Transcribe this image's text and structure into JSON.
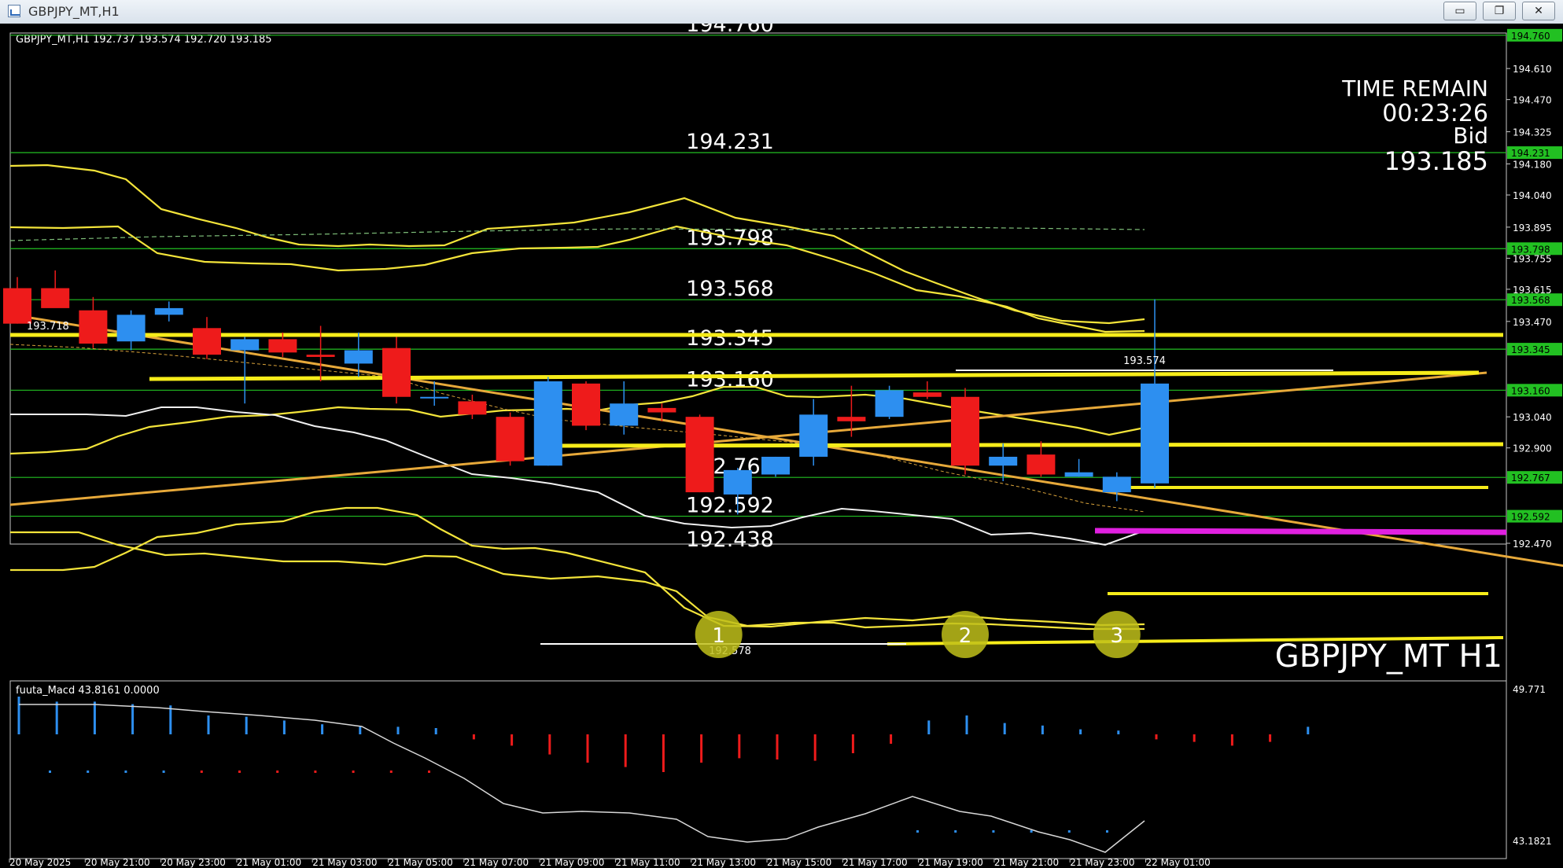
{
  "window": {
    "title": "GBPJPY_MT,H1",
    "min_glyph": "▭",
    "restore_glyph": "❐",
    "close_glyph": "✕"
  },
  "chart_data": {
    "type": "candlestick",
    "title": "GBPJPY_MT,H1",
    "header": "GBPJPY_MT,H1  192.737 193.574 192.720 193.185",
    "watermark": "GBPJPY_MT H1",
    "ylim": [
      192.47,
      194.77
    ],
    "time_remain": {
      "label": "TIME REMAIN",
      "value": "00:23:26",
      "bid_label": "Bid",
      "bid": "193.185"
    },
    "y_ticks": [
      "194.610",
      "194.470",
      "194.325",
      "194.180",
      "194.040",
      "193.895",
      "193.755",
      "193.615",
      "193.470",
      "193.040",
      "192.900",
      "192.470"
    ],
    "x_labels": [
      "20 May 2025",
      "20 May 21:00",
      "20 May 23:00",
      "21 May 01:00",
      "21 May 03:00",
      "21 May 05:00",
      "21 May 07:00",
      "21 May 09:00",
      "21 May 11:00",
      "21 May 13:00",
      "21 May 15:00",
      "21 May 17:00",
      "21 May 19:00",
      "21 May 21:00",
      "21 May 23:00",
      "22 May 01:00"
    ],
    "candles": [
      {
        "o": 193.62,
        "h": 193.67,
        "l": 193.46,
        "c": 193.46
      },
      {
        "o": 193.62,
        "h": 193.7,
        "l": 193.55,
        "c": 193.53
      },
      {
        "o": 193.52,
        "h": 193.58,
        "l": 193.35,
        "c": 193.37
      },
      {
        "o": 193.38,
        "h": 193.52,
        "l": 193.34,
        "c": 193.5
      },
      {
        "o": 193.5,
        "h": 193.56,
        "l": 193.47,
        "c": 193.53
      },
      {
        "o": 193.44,
        "h": 193.49,
        "l": 193.3,
        "c": 193.32
      },
      {
        "o": 193.34,
        "h": 193.4,
        "l": 193.1,
        "c": 193.39
      },
      {
        "o": 193.39,
        "h": 193.42,
        "l": 193.31,
        "c": 193.33
      },
      {
        "o": 193.32,
        "h": 193.45,
        "l": 193.2,
        "c": 193.31
      },
      {
        "o": 193.28,
        "h": 193.42,
        "l": 193.22,
        "c": 193.34
      },
      {
        "o": 193.35,
        "h": 193.4,
        "l": 193.1,
        "c": 193.13
      },
      {
        "o": 193.13,
        "h": 193.2,
        "l": 193.09,
        "c": 193.13
      },
      {
        "o": 193.11,
        "h": 193.14,
        "l": 193.03,
        "c": 193.05
      },
      {
        "o": 193.04,
        "h": 193.06,
        "l": 192.82,
        "c": 192.84
      },
      {
        "o": 192.82,
        "h": 193.22,
        "l": 192.82,
        "c": 193.2
      },
      {
        "o": 193.19,
        "h": 193.2,
        "l": 192.98,
        "c": 193.0
      },
      {
        "o": 193.0,
        "h": 193.2,
        "l": 192.96,
        "c": 193.1
      },
      {
        "o": 193.08,
        "h": 193.1,
        "l": 193.02,
        "c": 193.06
      },
      {
        "o": 193.04,
        "h": 193.05,
        "l": 192.7,
        "c": 192.7
      },
      {
        "o": 192.69,
        "h": 192.81,
        "l": 192.6,
        "c": 192.8
      },
      {
        "o": 192.78,
        "h": 192.86,
        "l": 192.77,
        "c": 192.86
      },
      {
        "o": 192.86,
        "h": 193.12,
        "l": 192.82,
        "c": 193.05
      },
      {
        "o": 193.04,
        "h": 193.18,
        "l": 192.95,
        "c": 193.02
      },
      {
        "o": 193.04,
        "h": 193.18,
        "l": 193.03,
        "c": 193.16
      },
      {
        "o": 193.15,
        "h": 193.2,
        "l": 193.12,
        "c": 193.13
      },
      {
        "o": 193.13,
        "h": 193.17,
        "l": 192.78,
        "c": 192.82
      },
      {
        "o": 192.82,
        "h": 192.92,
        "l": 192.75,
        "c": 192.86
      },
      {
        "o": 192.87,
        "h": 192.93,
        "l": 192.77,
        "c": 192.78
      },
      {
        "o": 192.77,
        "h": 192.85,
        "l": 192.77,
        "c": 192.79
      },
      {
        "o": 192.7,
        "h": 192.79,
        "l": 192.66,
        "c": 192.77
      },
      {
        "o": 192.74,
        "h": 193.57,
        "l": 192.72,
        "c": 193.19
      }
    ],
    "h_levels": [
      {
        "price": 194.76,
        "label": "194.760",
        "tag": "194.760"
      },
      {
        "price": 194.231,
        "label": "194.231",
        "tag": "194.231"
      },
      {
        "price": 193.798,
        "label": "193.798",
        "tag": "193.798"
      },
      {
        "price": 193.568,
        "label": "193.568",
        "tag": "193.568"
      },
      {
        "price": 193.345,
        "label": "193.345",
        "tag": "193.345"
      },
      {
        "price": 193.16,
        "label": "193.160",
        "tag": "193.160"
      },
      {
        "price": 192.767,
        "label": "192.767",
        "tag": "192.767"
      },
      {
        "price": 192.592,
        "label": "192.592",
        "tag": "192.592"
      },
      {
        "price": 192.438,
        "label": "192.438",
        "tag": ""
      }
    ],
    "annotations": {
      "high": "193.574",
      "low": "192.578",
      "left_high": "193.718"
    },
    "markers": [
      {
        "label": "1",
        "bar": 18.5
      },
      {
        "label": "2",
        "bar": 25
      },
      {
        "label": "3",
        "bar": 29
      }
    ],
    "macd": {
      "title": "fuuta_Macd 43.8161  0.0000",
      "max": "49.771",
      "min": "43.1821"
    }
  }
}
